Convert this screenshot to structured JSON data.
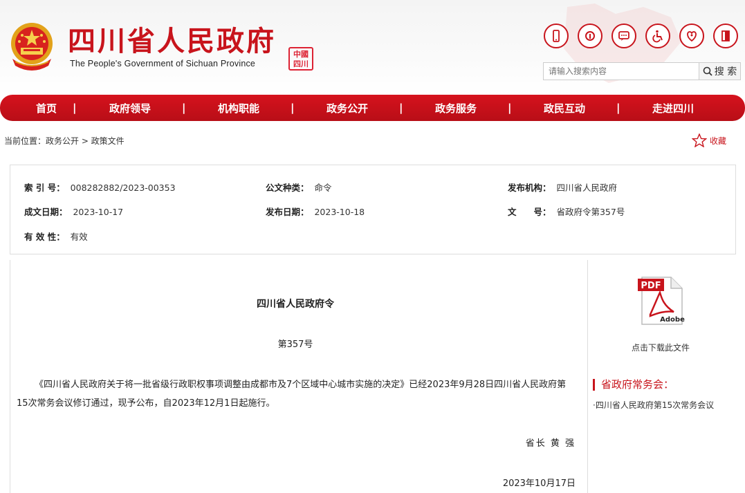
{
  "header": {
    "title": "四川省人民政府",
    "subtitle": "The People's Government of Sichuan Province",
    "seal_text": "中國四川",
    "search_placeholder": "请输入搜索内容",
    "search_button": "搜 索",
    "icons": [
      "mobile-icon",
      "weibo-icon",
      "wechat-icon",
      "accessibility-icon",
      "elderly-care-icon",
      "exit-icon"
    ]
  },
  "nav": {
    "items": [
      "首页",
      "政府领导",
      "机构职能",
      "政务公开",
      "政务服务",
      "政民互动",
      "走进四川"
    ],
    "separator": "|"
  },
  "breadcrumb": {
    "text": "当前位置：政务公开 > 政策文件"
  },
  "favorite": {
    "label": "收藏"
  },
  "info": {
    "index_label": "索 引 号：",
    "index_value": "008282882/2023-00353",
    "type_label": "公文种类：",
    "type_value": "命令",
    "issuer_label": "发布机构：",
    "issuer_value": "四川省人民政府",
    "created_label": "成文日期：",
    "created_value": "2023-10-17",
    "published_label": "发布日期：",
    "published_value": "2023-10-18",
    "docno_label": "文　　号：",
    "docno_value": "省政府令第357号",
    "validity_label": "有 效 性：",
    "validity_value": "有效"
  },
  "document": {
    "title": "四川省人民政府令",
    "number": "第357号",
    "body": "《四川省人民政府关于将一批省级行政职权事项调整由成都市及7个区域中心城市实施的决定》已经2023年9月28日四川省人民政府第15次常务会议修订通过，现予公布，自2023年12月1日起施行。",
    "signature": "省长 黄 强",
    "date": "2023年10月17日"
  },
  "sidebar": {
    "pdf_label": "PDF",
    "adobe_label": "Adobe",
    "download_label": "点击下载此文件",
    "section_title": "省政府常务会：",
    "link": "·四川省人民政府第15次常务会议"
  },
  "colors": {
    "brand_red": "#c8141c",
    "nav_red": "#d6121d"
  }
}
